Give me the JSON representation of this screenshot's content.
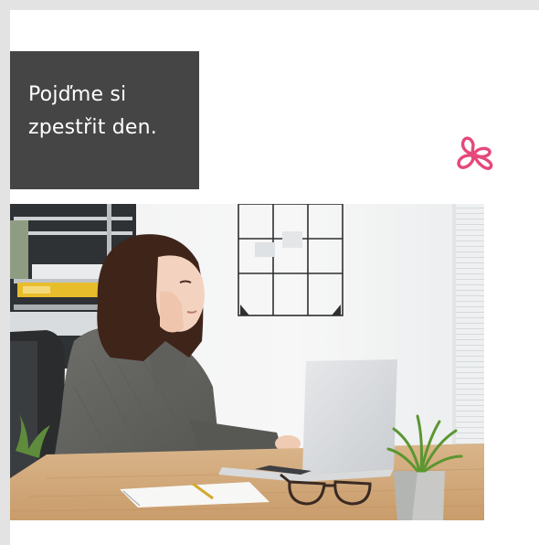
{
  "headline": {
    "line1": "Pojďme si",
    "line2": "zpestřit den."
  },
  "logo": {
    "icon": "butterfly-icon",
    "color": "#e5487a"
  },
  "photo": {
    "subject": "office-worker-photo"
  },
  "colors": {
    "page_background": "#e3e3e3",
    "card_background": "#ffffff",
    "headline_box": "#454545",
    "headline_text": "#ffffff",
    "accent": "#e5487a"
  }
}
